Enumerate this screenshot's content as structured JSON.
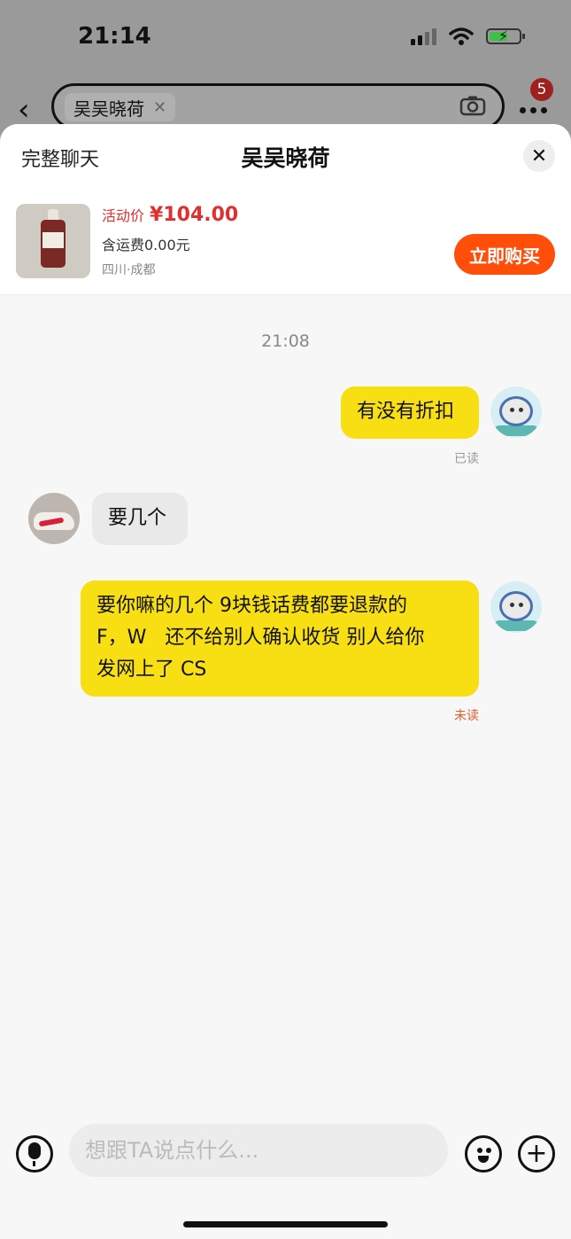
{
  "status_bar": {
    "time": "21:14"
  },
  "background_page": {
    "search_chip": "吴吴晓荷",
    "notification_count": "5"
  },
  "sheet": {
    "full_chat_label": "完整聊天",
    "title": "吴吴晓荷",
    "close_icon": "close-icon"
  },
  "product": {
    "price_label": "活动价",
    "price": "¥104.00",
    "shipping": "含运费0.00元",
    "location": "四川·成都",
    "buy_label": "立即购买"
  },
  "chat": {
    "timestamp": "21:08",
    "messages": [
      {
        "sender": "me",
        "text": "有没有折扣",
        "status": "已读"
      },
      {
        "sender": "them",
        "text": "要几个"
      },
      {
        "sender": "me",
        "line1": "要你嘛的几个 9块钱话费都要退款的",
        "line2": "F，W   还不给别人确认收货 别人给你",
        "line3": "发网上了 CS",
        "status": "未读"
      }
    ]
  },
  "input_bar": {
    "placeholder": "想跟TA说点什么..."
  },
  "colors": {
    "my_bubble": "#f8df14",
    "their_bubble": "#e9e9e9",
    "price_red": "#e02f2f",
    "buy_button": "#ff4e0a",
    "unread_red": "#e85a2c"
  }
}
